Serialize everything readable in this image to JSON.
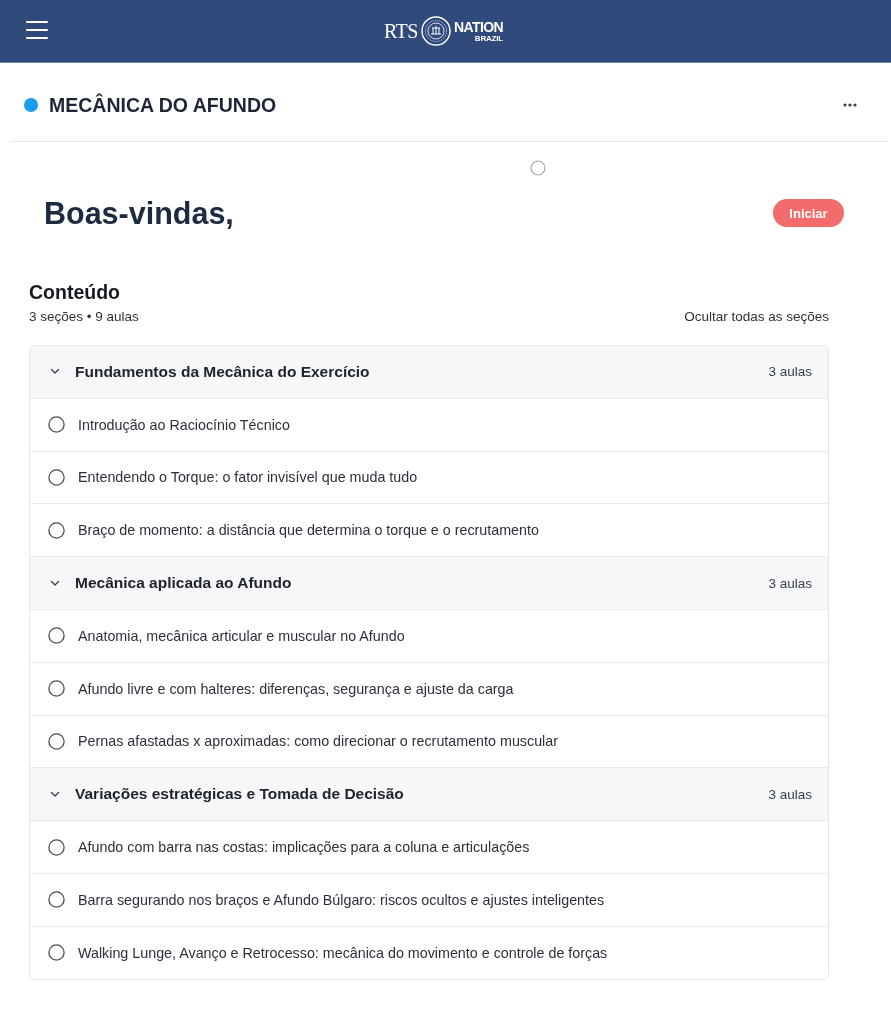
{
  "header": {
    "logo": {
      "left_text": "RTS",
      "right_text": "NATION",
      "subtext": "BRAZIL"
    }
  },
  "course": {
    "title": "MECÂNICA DO AFUNDO"
  },
  "welcome": {
    "heading": "Boas-vindas,",
    "start_button": "Iniciar"
  },
  "content": {
    "heading": "Conteúdo",
    "summary": "3 seções • 9 aulas",
    "collapse_all": "Ocultar todas as seções",
    "sections": [
      {
        "title": "Fundamentos da Mecânica do Exercício",
        "count": "3 aulas",
        "expanded": true,
        "lessons": [
          {
            "title": "Introdução ao Raciocínio Técnico",
            "completed": false
          },
          {
            "title": "Entendendo o Torque: o fator invisível que muda tudo",
            "completed": false
          },
          {
            "title": "Braço de momento: a distância que determina o torque e o recrutamento",
            "completed": false
          }
        ]
      },
      {
        "title": "Mecânica aplicada ao Afundo",
        "count": "3 aulas",
        "expanded": true,
        "lessons": [
          {
            "title": "Anatomia, mecânica articular e muscular no Afundo",
            "completed": false
          },
          {
            "title": "Afundo livre e com halteres: diferenças, segurança e ajuste da carga",
            "completed": false
          },
          {
            "title": "Pernas afastadas x aproximadas: como direcionar o recrutamento muscular",
            "completed": false
          }
        ]
      },
      {
        "title": "Variações estratégicas e Tomada de Decisão",
        "count": "3 aulas",
        "expanded": true,
        "lessons": [
          {
            "title": "Afundo com barra nas costas: implicações para a coluna e articulações",
            "completed": false
          },
          {
            "title": "Barra segurando nos braços e Afundo Búlgaro: riscos ocultos e ajustes inteligentes",
            "completed": false
          },
          {
            "title": "Walking Lunge, Avanço e Retrocesso: mecânica do movimento e controle de forças",
            "completed": false
          }
        ]
      }
    ]
  }
}
